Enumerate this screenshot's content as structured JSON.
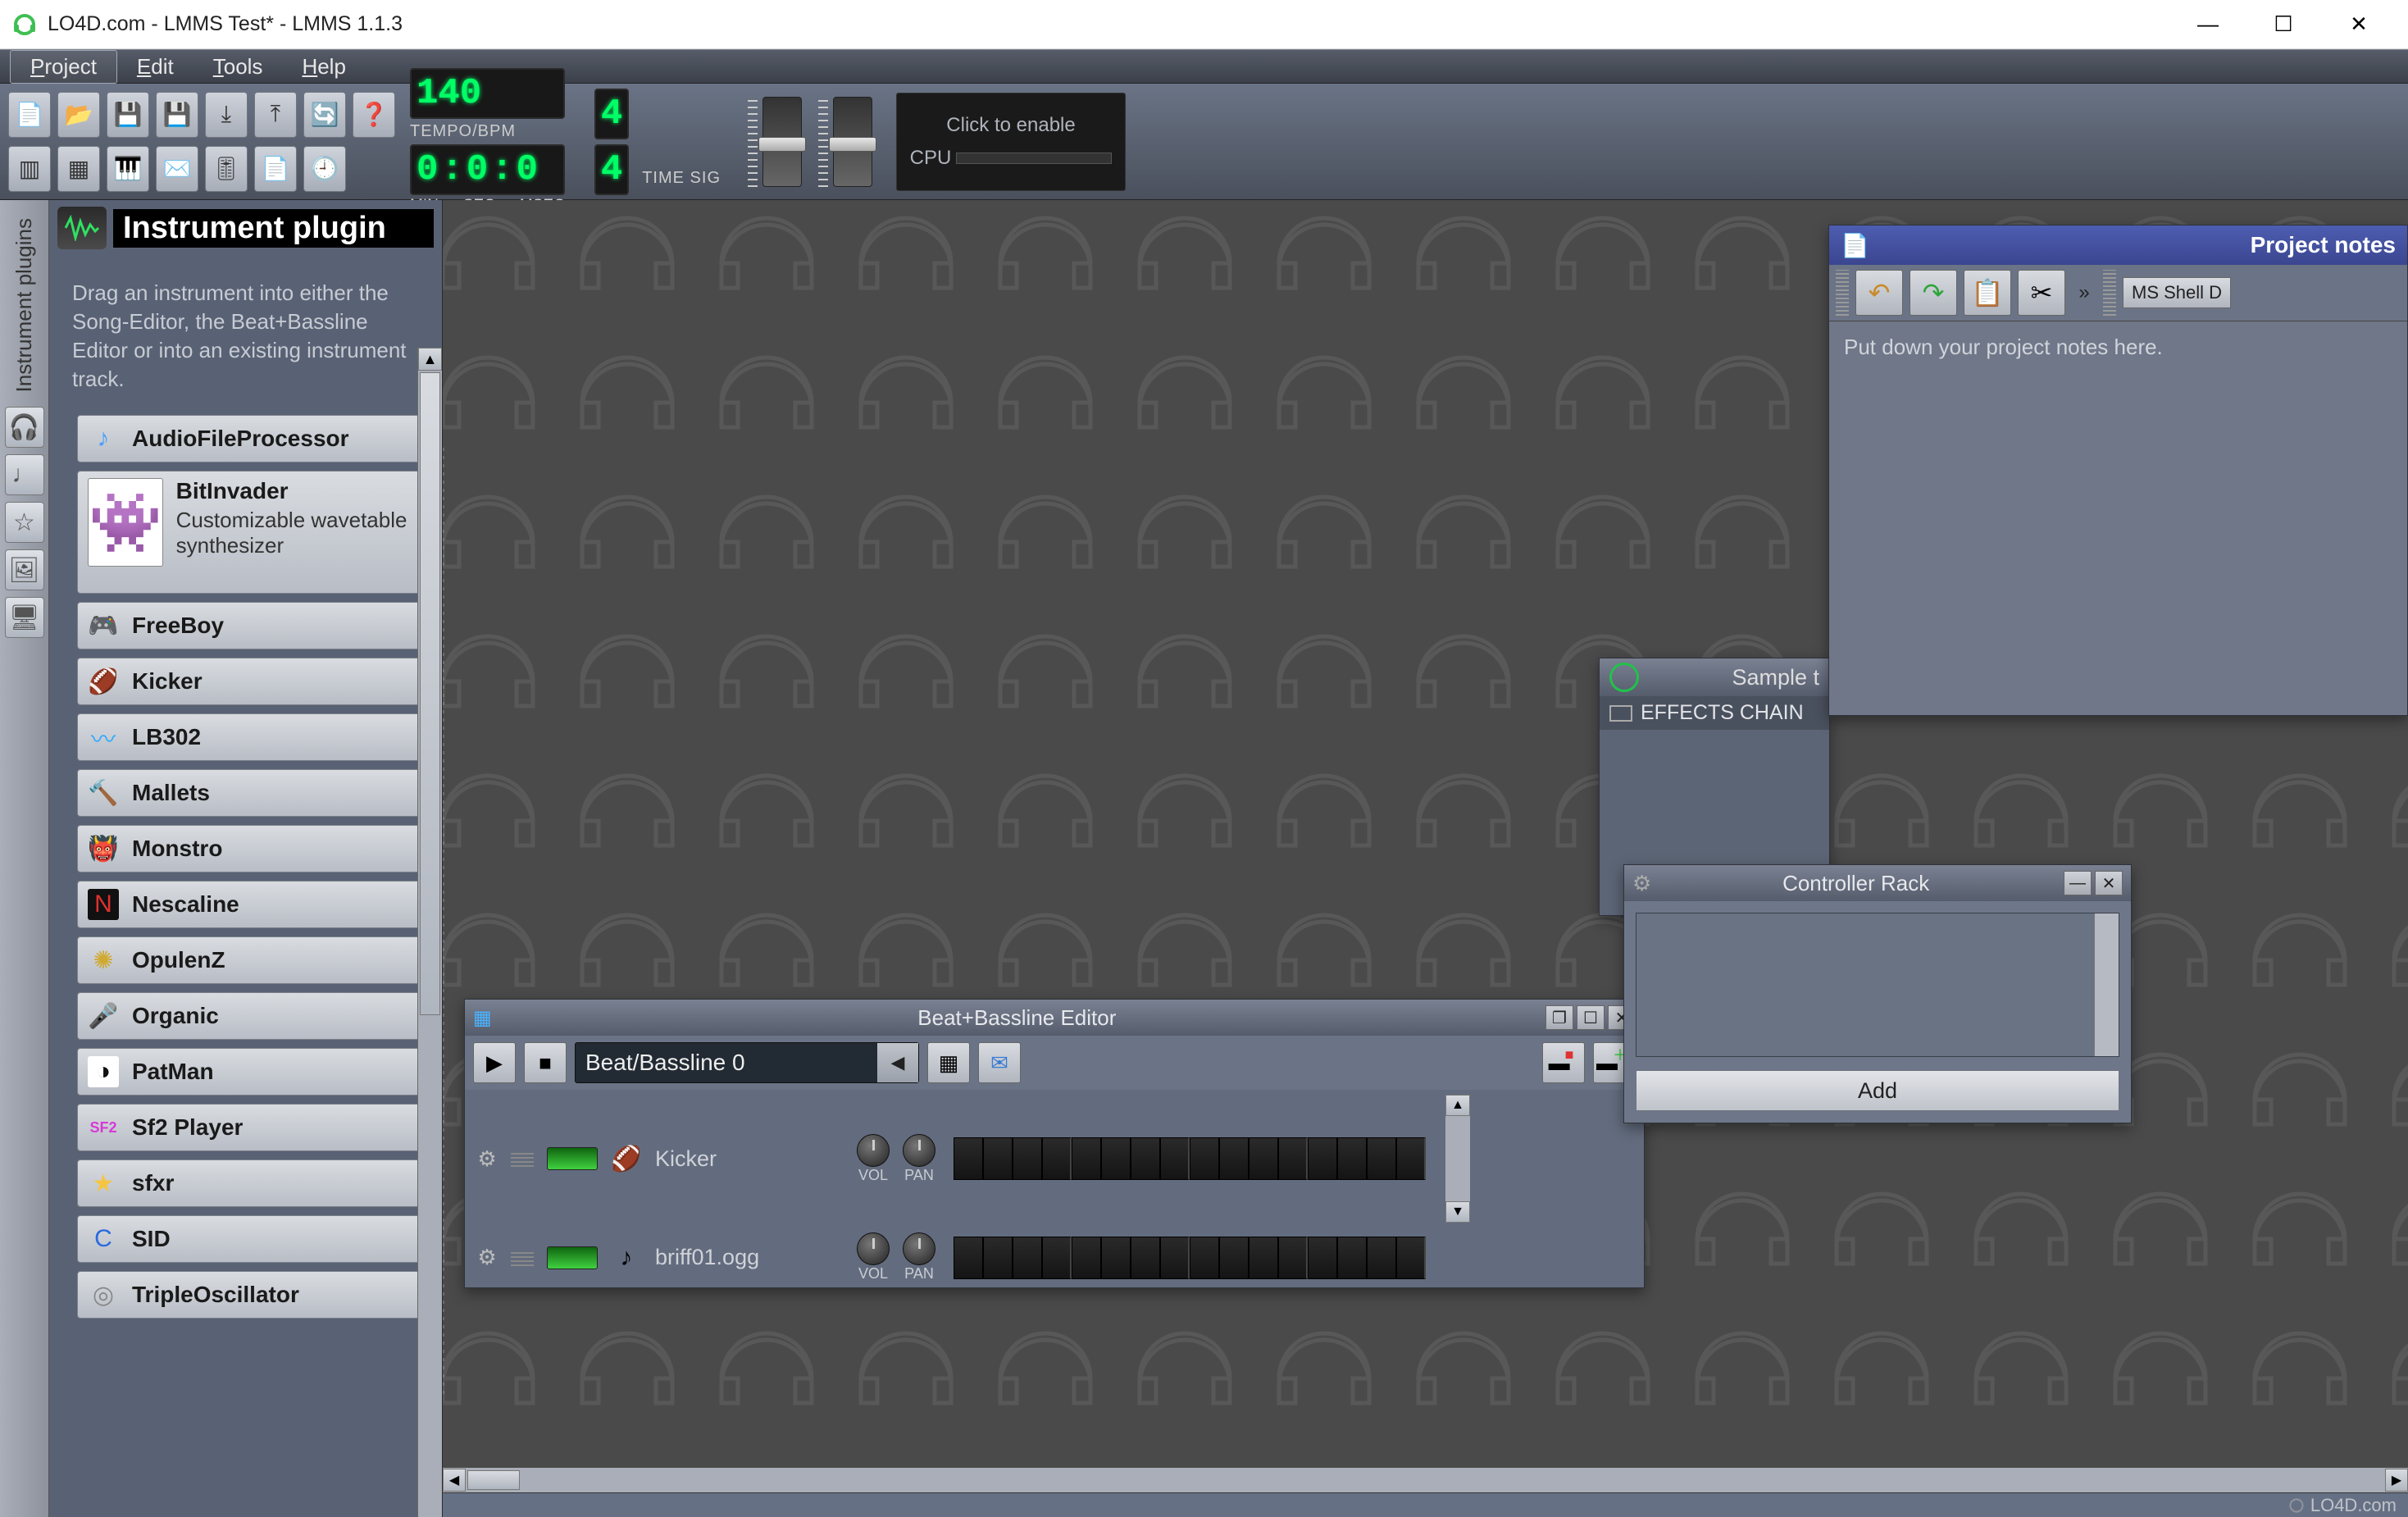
{
  "window": {
    "title": "LO4D.com - LMMS Test* - LMMS 1.1.3",
    "minimize_glyph": "—",
    "maximize_glyph": "☐",
    "close_glyph": "✕"
  },
  "menubar": [
    {
      "label": "Project",
      "underline": "P",
      "active": true
    },
    {
      "label": "Edit",
      "underline": "E"
    },
    {
      "label": "Tools",
      "underline": "T"
    },
    {
      "label": "Help",
      "underline": "H"
    }
  ],
  "toolbar": {
    "row1_icons": [
      "📄",
      "📂",
      "💾",
      "💾",
      "⤓",
      "⤒",
      "🔄",
      "❓"
    ],
    "row2_icons": [
      "▥",
      "▦",
      "🎹",
      "✉️",
      "🎚",
      "📄",
      "🕘"
    ],
    "tempo": {
      "value": "140",
      "label": "TEMPO/BPM"
    },
    "timer": {
      "min": "0",
      "sec": "0",
      "msec": "0",
      "min_label": "MIN",
      "sec_label": "SEC",
      "msec_label": "MSEC"
    },
    "timesig": {
      "num": "4",
      "den": "4",
      "label": "TIME SIG"
    },
    "visualizer": {
      "hint": "Click to enable",
      "cpu_label": "CPU"
    }
  },
  "watermark_text": "LO4D.com",
  "vtabs": {
    "active_label": "Instrument plugins",
    "icons": [
      "🎧",
      "♩",
      "☆",
      "🖼",
      "🖥"
    ]
  },
  "side_panel": {
    "title": "Instrument plugin",
    "hint": "Drag an instrument into either the Song-Editor, the Beat+Bassline Editor or into an existing instrument track.",
    "plugins": [
      {
        "name": "AudioFileProcessor",
        "icon": "♪",
        "icon_color": "#4aa0ff"
      },
      {
        "name": "BitInvader",
        "icon": "👾",
        "desc": "Customizable wavetable synthesizer",
        "expanded": true
      },
      {
        "name": "FreeBoy",
        "icon": "🎮",
        "icon_color": "#999"
      },
      {
        "name": "Kicker",
        "icon": "🏈",
        "icon_color": "#c06a2f"
      },
      {
        "name": "LB302",
        "icon": "〰",
        "icon_color": "#33aaff"
      },
      {
        "name": "Mallets",
        "icon": "🔨",
        "icon_color": "#c79a4f"
      },
      {
        "name": "Monstro",
        "icon": "👹",
        "icon_color": "#d08a2a"
      },
      {
        "name": "Nescaline",
        "icon": "N",
        "icon_color": "#e03030",
        "icon_bg": "#111"
      },
      {
        "name": "OpulenZ",
        "icon": "✺",
        "icon_color": "#d0a92f"
      },
      {
        "name": "Organic",
        "icon": "🎤",
        "icon_color": "#2fb54a"
      },
      {
        "name": "PatMan",
        "icon": "◑",
        "icon_color": "#111",
        "icon_bg": "#fff"
      },
      {
        "name": "Sf2 Player",
        "icon": "SF2",
        "icon_color": "#d63ad6"
      },
      {
        "name": "sfxr",
        "icon": "★",
        "icon_color": "#f5c542"
      },
      {
        "name": "SID",
        "icon": "C",
        "icon_color": "#2a6adf"
      },
      {
        "name": "TripleOscillator",
        "icon": "◎",
        "icon_color": "#888"
      }
    ]
  },
  "beat_bassline": {
    "title": "Beat+Bassline Editor",
    "pattern_name": "Beat/Bassline 0",
    "vol_label": "VOL",
    "pan_label": "PAN",
    "tracks": [
      {
        "name": "Kicker",
        "icon": "🏈",
        "led": "#40d040"
      },
      {
        "name": "briff01.ogg",
        "icon": "♪",
        "led": "#40d040"
      }
    ]
  },
  "project_notes": {
    "title": "Project notes",
    "font_selector": "MS Shell D",
    "placeholder": "Put down your project notes here."
  },
  "sample_track": {
    "title": "Sample t",
    "effects_label": "EFFECTS CHAIN"
  },
  "controller_rack": {
    "title": "Controller Rack",
    "add_label": "Add"
  },
  "footer_brand": "LO4D.com"
}
